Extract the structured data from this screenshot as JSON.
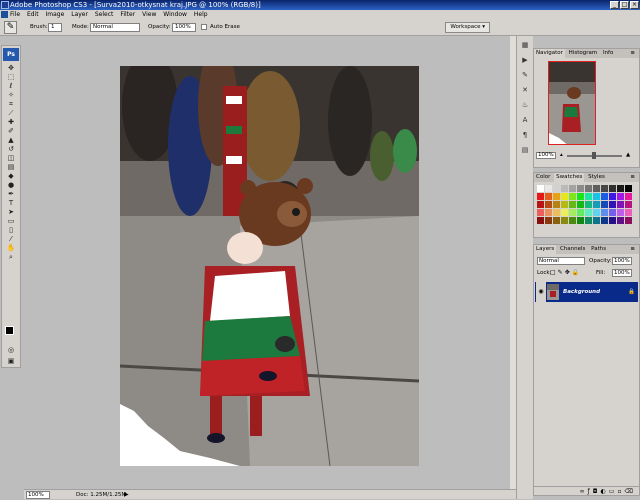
{
  "title": "Adobe Photoshop CS3 - [Surva2010-otkysnat kraj.JPG @ 100% (RGB/8)]",
  "window_controls": [
    "_",
    "□",
    "×"
  ],
  "menu": [
    "File",
    "Edit",
    "Image",
    "Layer",
    "Select",
    "Filter",
    "View",
    "Window",
    "Help"
  ],
  "options": {
    "brush_label": "Brush:",
    "brush_size": "1",
    "mode_label": "Mode:",
    "mode_value": "Normal",
    "opacity_label": "Opacity:",
    "opacity_value": "100%",
    "erase_label": "Auto Erase",
    "workspace_label": "Workspace ▾"
  },
  "status": {
    "zoom": "100%",
    "doc": "Doc: 1.25M/1.25M",
    "arrow": "▶"
  },
  "navigator": {
    "tabs": [
      "Navigator",
      "Histogram",
      "Info"
    ],
    "zoom": "100%"
  },
  "swatches": {
    "tabs": [
      "Color",
      "Swatches",
      "Styles"
    ]
  },
  "layers": {
    "tabs": [
      "Layers",
      "Channels",
      "Paths"
    ],
    "blend": "Normal",
    "opacity_label": "Opacity:",
    "opacity_value": "100%",
    "lock_label": "Lock:",
    "fill_label": "Fill:",
    "fill_value": "100%",
    "layer_name": "Background"
  },
  "colors": {
    "title_bar": "#0a246a",
    "panel_bg": "#d6d3ce",
    "layer_selected": "#0a2a8a"
  }
}
